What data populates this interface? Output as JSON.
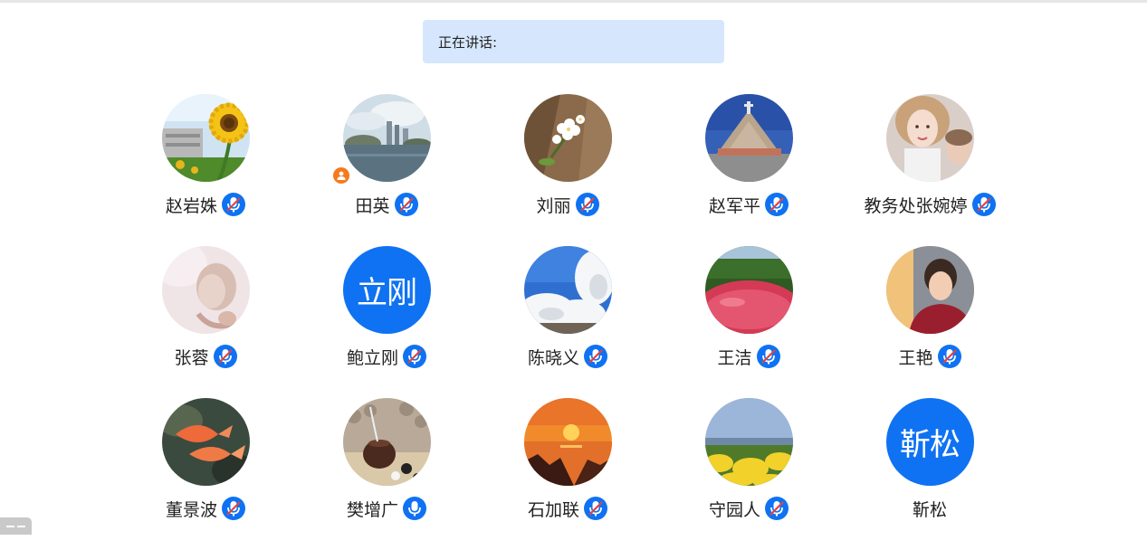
{
  "speaking": {
    "label": "正在讲话:"
  },
  "participants": [
    {
      "name": "赵岩姝",
      "avatar": "photo-sunflower-icon",
      "mic": "muted"
    },
    {
      "name": "田英",
      "avatar": "photo-city-skyline-icon",
      "mic": "muted",
      "host": true
    },
    {
      "name": "刘丽",
      "avatar": "photo-white-flowers-icon",
      "mic": "muted"
    },
    {
      "name": "赵军平",
      "avatar": "photo-monument-icon",
      "mic": "muted"
    },
    {
      "name": "教务处张婉婷",
      "avatar": "photo-portrait-woman-icon",
      "mic": "muted"
    },
    {
      "name": "张蓉",
      "avatar": "photo-soft-art-icon",
      "mic": "muted"
    },
    {
      "name": "鲍立刚",
      "avatar_text": "立刚",
      "mic": "muted"
    },
    {
      "name": "陈晓义",
      "avatar": "photo-blossom-tree-icon",
      "mic": "muted"
    },
    {
      "name": "王洁",
      "avatar": "photo-red-flowerbed-icon",
      "mic": "muted"
    },
    {
      "name": "王艳",
      "avatar": "photo-portrait-sunset-icon",
      "mic": "muted"
    },
    {
      "name": "董景波",
      "avatar": "photo-goldfish-icon",
      "mic": "muted"
    },
    {
      "name": "樊增广",
      "avatar": "photo-teapot-icon",
      "mic": "unmuted"
    },
    {
      "name": "石加联",
      "avatar": "photo-sunset-sea-icon",
      "mic": "muted"
    },
    {
      "name": "守园人",
      "avatar": "photo-rapeseed-field-icon",
      "mic": "muted"
    },
    {
      "name": "靳松",
      "avatar_text": "靳松",
      "mic": "none"
    }
  ],
  "colors": {
    "accent": "#0f72f2",
    "speaking_bg": "#d6e7fd",
    "host_badge": "#f47a1d",
    "mute_slash": "#e0453f"
  }
}
